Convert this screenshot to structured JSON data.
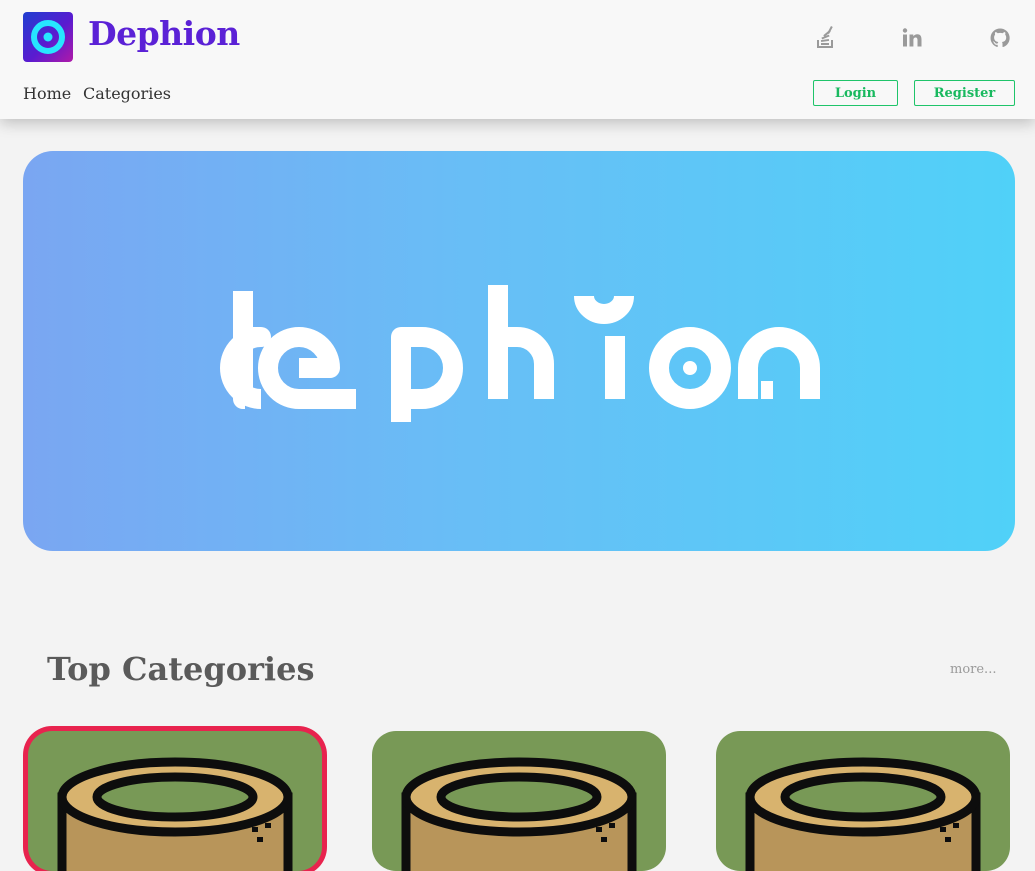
{
  "header": {
    "brand": "Dephion",
    "social": [
      "stackoverflow-icon",
      "linkedin-icon",
      "github-icon"
    ],
    "nav": [
      {
        "label": "Home"
      },
      {
        "label": "Categories"
      }
    ],
    "login_label": "Login",
    "register_label": "Register"
  },
  "banner": {
    "logo_text": "dephion",
    "gradient": [
      "#7aa6f2",
      "#50d1f8"
    ]
  },
  "top_categories": {
    "title": "Top Categories",
    "more_label": "more...",
    "cards": [
      {
        "icon": "tape-icon",
        "selected": true
      },
      {
        "icon": "tape-icon",
        "selected": false
      },
      {
        "icon": "tape-icon",
        "selected": false
      }
    ]
  },
  "colors": {
    "brand": "#5b21d6",
    "accent_green": "#1fc46a",
    "card_bg": "#789956",
    "selected_border": "#e8234e"
  }
}
